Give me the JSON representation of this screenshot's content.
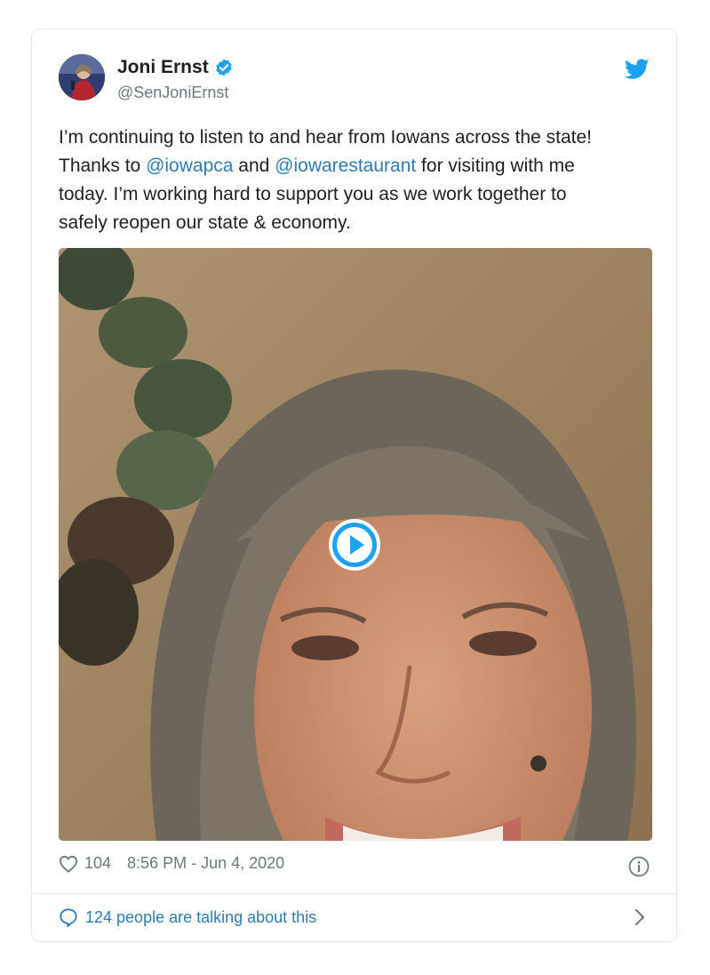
{
  "author": {
    "name": "Joni Ernst",
    "handle": "@SenJoniErnst"
  },
  "icons": {
    "verified": "verified-badge-icon",
    "brand": "twitter-bird-icon",
    "play": "play-icon",
    "like": "heart-icon",
    "info": "info-icon",
    "talk": "speech-bubble-icon",
    "chevron": "chevron-right-icon"
  },
  "tweet": {
    "line1": "I’m continuing to listen to and hear from Iowans across the state!",
    "line2_pre": "Thanks to ",
    "mention1": "@iowapca",
    "line2_mid": " and ",
    "mention2": "@iowarestaurant",
    "line2_post": " for visiting with me",
    "line3": "today. I’m working hard to support you as we work together to",
    "line4": "safely reopen our state & economy."
  },
  "footer": {
    "likes": "104",
    "timestamp": "8:56 PM - Jun 4, 2020",
    "talking": "124 people are talking about this"
  },
  "colors": {
    "link": "#2b7bb9",
    "muted": "#697882",
    "brand": "#1da1f2"
  }
}
